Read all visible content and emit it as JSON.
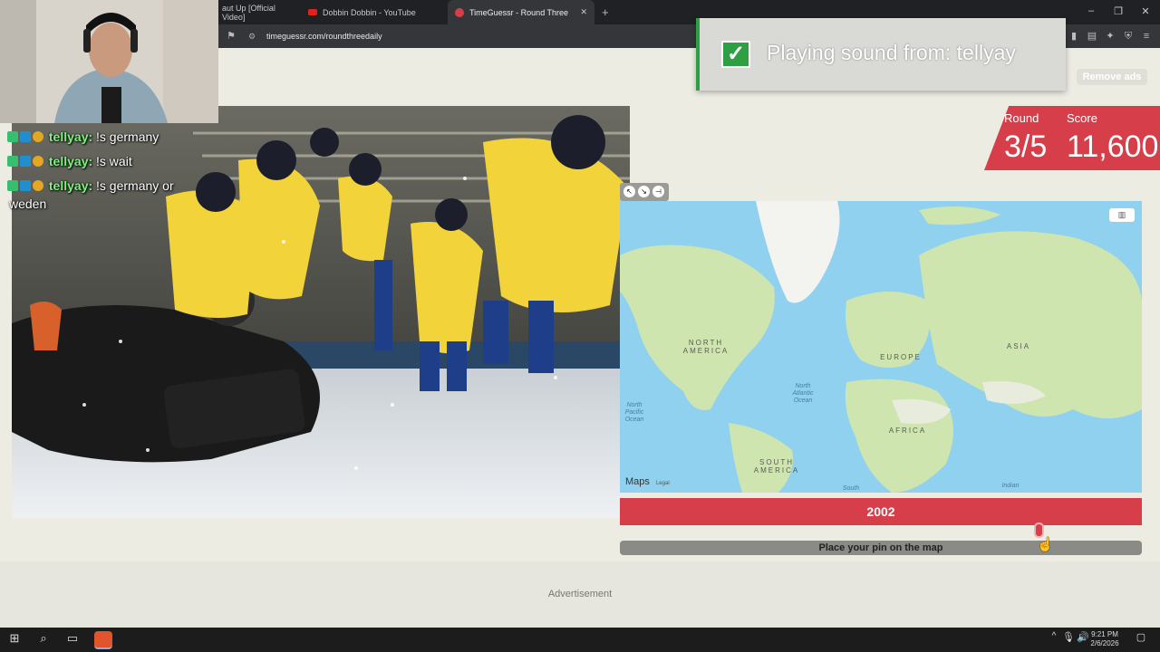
{
  "browser": {
    "tabs": [
      {
        "label": "aut Up [Official Video]"
      },
      {
        "label": "Dobbin Dobbin - YouTube"
      },
      {
        "label": "TimeGuessr - Round Three"
      }
    ],
    "url": "timeguessr.com/roundthreedaily"
  },
  "notification": {
    "text": "Playing sound from: tellyay"
  },
  "header": {
    "remove_ads": "Remove ads"
  },
  "score": {
    "round_label": "Round",
    "score_label": "Score",
    "round_value": "3/5",
    "score_value": "11,600"
  },
  "map": {
    "labels": {
      "north_america": "NORTH\nAMERICA",
      "europe": "EUROPE",
      "asia": "ASIA",
      "africa": "AFRICA",
      "south_america": "SOUTH\nAMERICA",
      "north_atlantic": "North\nAtlantic\nOcean",
      "north_pacific": "North\nPacific\nOcean",
      "south": "South",
      "indian": "Indian"
    },
    "attribution": "Maps",
    "legal": "Legal"
  },
  "year": {
    "value": "2002",
    "slider_fraction": 0.83
  },
  "place_pin": "Place your pin on the map",
  "ad": "Advertisement",
  "chat": [
    {
      "user": "tellyay:",
      "message": "!s germany"
    },
    {
      "user": "tellyay:",
      "message": "!s wait"
    },
    {
      "user": "tellyay:",
      "message": "!s germany or"
    },
    {
      "user": "",
      "message": "weden"
    }
  ],
  "taskbar": {
    "time": "9:21 PM",
    "date": "2/6/2026"
  },
  "colors": {
    "accent": "#d63f4a",
    "background": "#edece3",
    "chat_name": "#7ef27e"
  }
}
